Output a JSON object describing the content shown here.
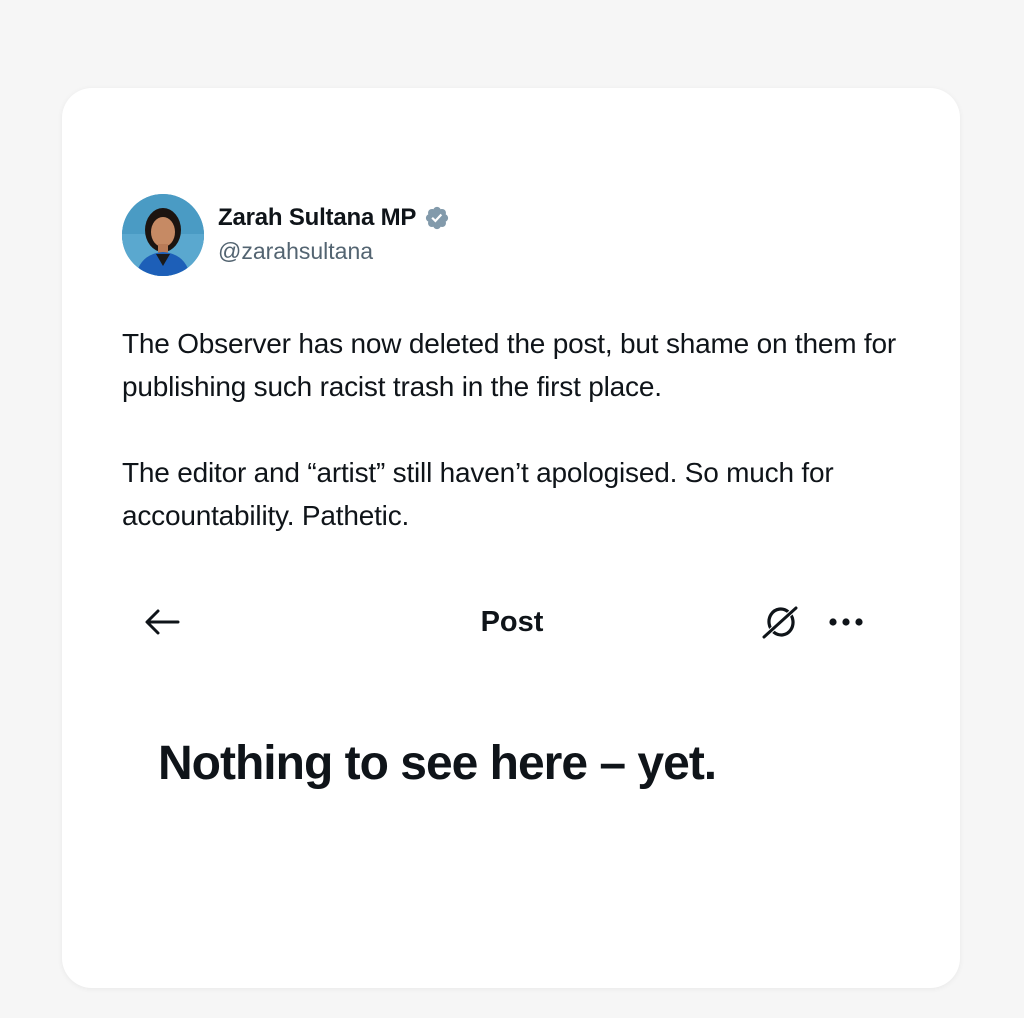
{
  "tweet": {
    "author_name": "Zarah Sultana MP",
    "author_handle": "@zarahsultana",
    "verified_icon": "verified-badge-icon",
    "paragraphs": [
      "The Observer has now deleted the post, but shame on them for publishing such racist trash in the first place.",
      "The editor and “artist” still haven’t apologised. So much for accountability. Pathetic."
    ]
  },
  "embedded_screen": {
    "title": "Post",
    "back_icon": "arrow-left-icon",
    "grok_icon": "grok-icon",
    "more_icon": "more-horizontal-icon",
    "empty_state_heading": "Nothing to see here – yet."
  },
  "colors": {
    "page_background": "#f6f6f6",
    "card_background": "#ffffff",
    "text_primary": "#0f1419",
    "text_secondary": "#536471",
    "verified_badge": "#829aab"
  }
}
